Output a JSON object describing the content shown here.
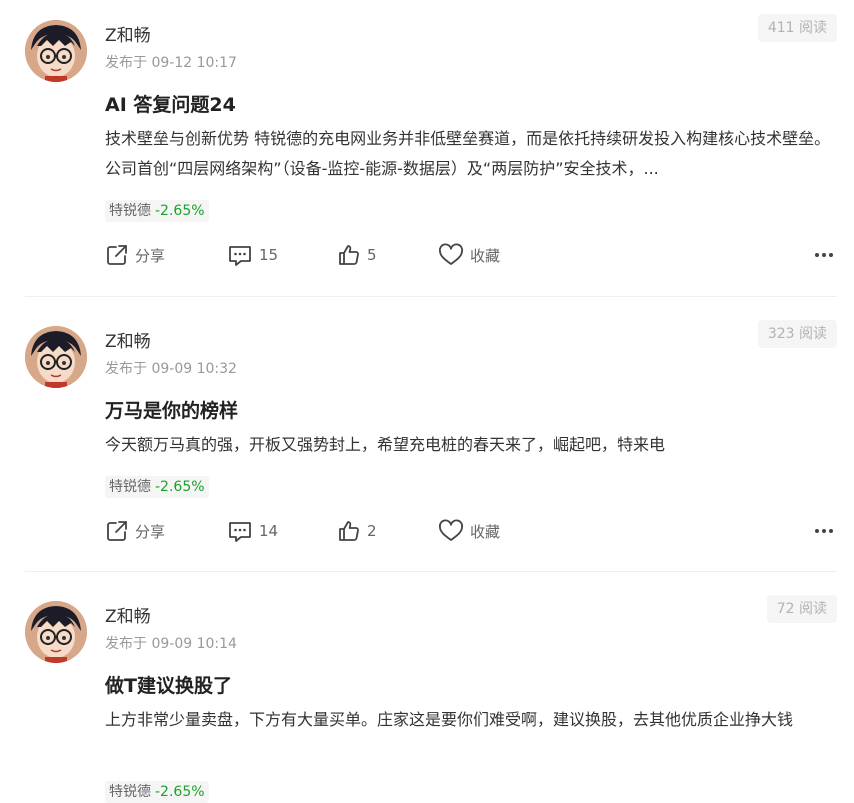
{
  "posts": [
    {
      "author": "Z和畅",
      "time": "发布于 09-12 10:17",
      "reads": "411 阅读",
      "title": "AI 答复问题24",
      "body": "技术壁垒与创新优势 特锐德的充电网业务并非低壁垒赛道，而是依托持续研发投入构建核心技术壁垒。公司首创“四层网络架构”（设备-监控-能源-数据层）及“两层防护”安全技术，...",
      "stock_name": "特锐德",
      "stock_change": "-2.65%",
      "share_label": "分享",
      "comments": "15",
      "likes": "5",
      "favorite_label": "收藏"
    },
    {
      "author": "Z和畅",
      "time": "发布于 09-09 10:32",
      "reads": "323 阅读",
      "title": "万马是你的榜样",
      "body": "今天额万马真的强，开板又强势封上，希望充电桩的春天来了，崛起吧，特来电",
      "stock_name": "特锐德",
      "stock_change": "-2.65%",
      "share_label": "分享",
      "comments": "14",
      "likes": "2",
      "favorite_label": "收藏"
    },
    {
      "author": "Z和畅",
      "time": "发布于 09-09 10:14",
      "reads": "72 阅读",
      "title": "做T建议换股了",
      "body": "上方非常少量卖盘，下方有大量买单。庄家这是要你们难受啊，建议换股，去其他优质企业挣大钱",
      "stock_name": "特锐德",
      "stock_change": "-2.65%"
    }
  ],
  "icons": {
    "share": "share-icon",
    "comment": "comment-icon",
    "like": "thumbs-up-icon",
    "favorite": "heart-icon",
    "more": "more-dots-icon"
  },
  "colors": {
    "stock_down": "#1aa22a",
    "read_badge_bg": "#f5f5f5",
    "divider": "#eeeeee"
  }
}
